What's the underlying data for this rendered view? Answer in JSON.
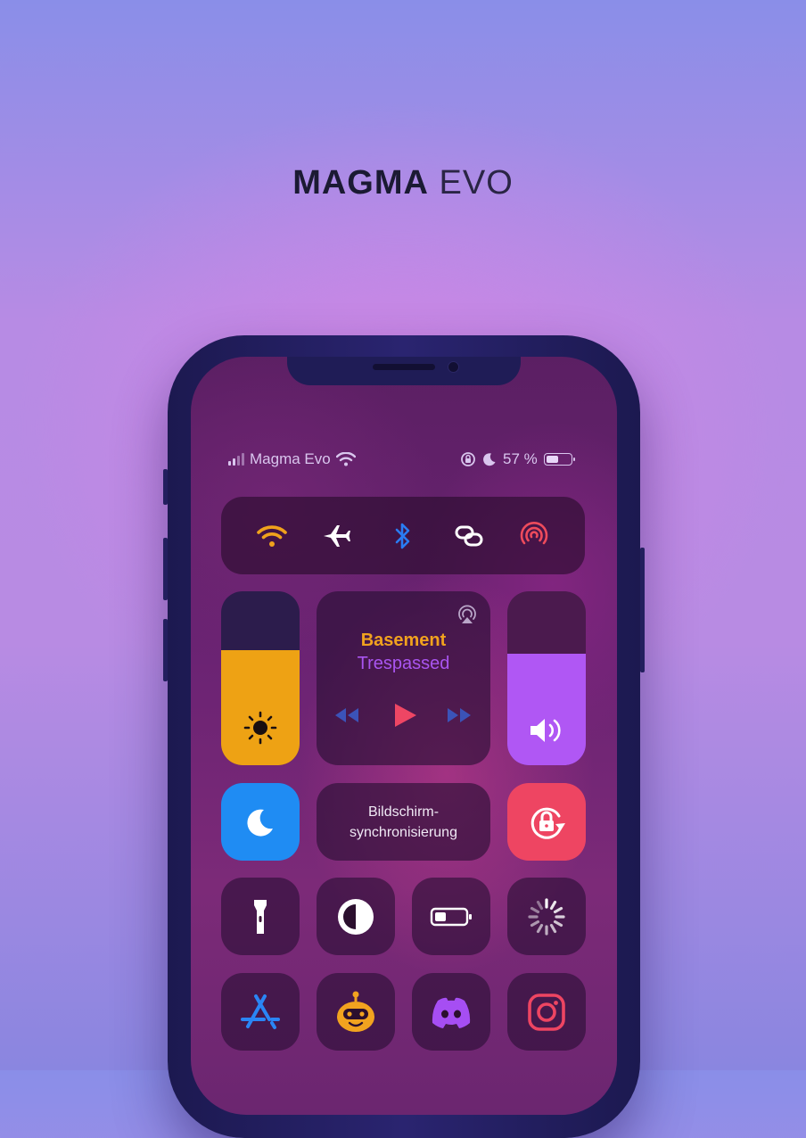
{
  "headline": {
    "bold": "MAGMA",
    "thin": "EVO"
  },
  "status_bar": {
    "carrier": "Magma Evo",
    "battery_percent": "57 %",
    "battery_level": 0.57
  },
  "connectivity": {
    "icons": [
      "wifi-icon",
      "airplane-icon",
      "bluetooth-icon",
      "link-icon",
      "airdrop-icon"
    ],
    "colors": {
      "wifi": "#f0a21c",
      "airplane": "#ffffff",
      "bluetooth": "#2a7cf3",
      "link": "#ffffff",
      "airdrop": "#ee4b5c"
    }
  },
  "brightness": {
    "level": 0.66,
    "color": "#eea214",
    "icon": "sun-icon"
  },
  "volume": {
    "level": 0.64,
    "color": "#b057f4",
    "icon": "speaker-icon"
  },
  "media": {
    "title": "Basement",
    "artist": "Trespassed",
    "title_color": "#f1a21e",
    "artist_color": "#a955f0",
    "controls": [
      "rewind-icon",
      "play-icon",
      "fast-forward-icon"
    ]
  },
  "focus_tile": {
    "icon": "moon-icon",
    "color": "#1f8cf3"
  },
  "screen_mirroring": {
    "line1": "Bildschirm-",
    "line2": "synchronisierung"
  },
  "rotation_lock": {
    "icon": "rotation-lock-icon",
    "color": "#ee4562"
  },
  "utility_row": [
    "flashlight-icon",
    "dark-mode-icon",
    "low-power-icon",
    "loading-icon"
  ],
  "apps_row": [
    "app-store-icon",
    "robot-app-icon",
    "discord-icon",
    "instagram-icon"
  ]
}
